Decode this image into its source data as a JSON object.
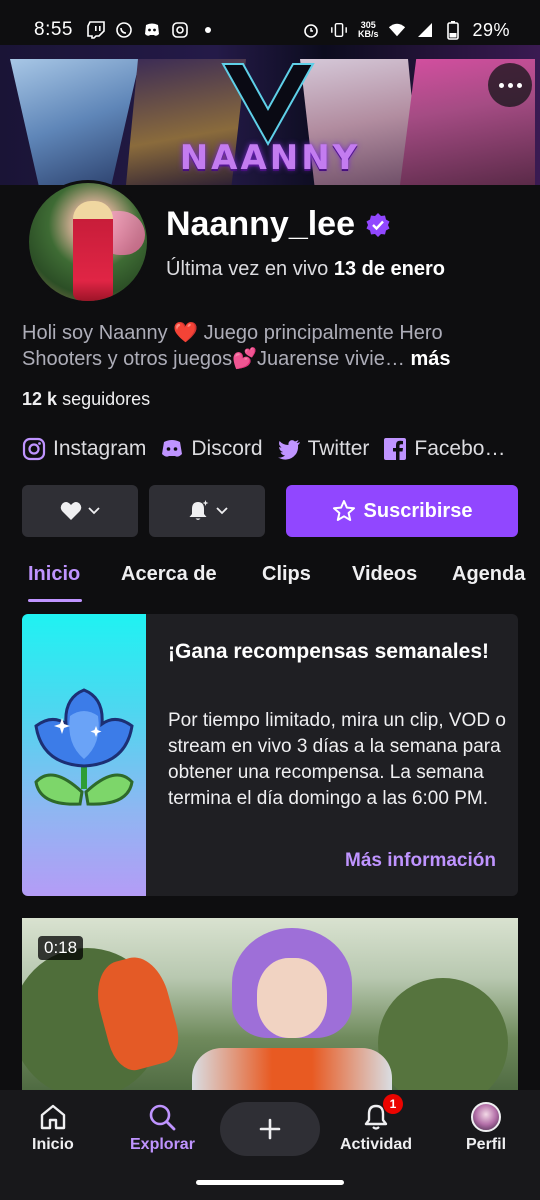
{
  "status_bar": {
    "time": "8:55",
    "speed_value": "305",
    "speed_unit": "KB/s",
    "battery": "29%"
  },
  "banner": {
    "name": "NAANNY"
  },
  "channel": {
    "name": "Naanny_lee",
    "last_live_prefix": "Última vez en vivo",
    "last_live_date": "13 de enero",
    "bio_text": "Holi soy Naanny ❤️ Juego principalmente Hero Shooters y otros juegos💕Juarense vivie…",
    "bio_more": "más",
    "followers_count": "12 k",
    "followers_label": "seguidores"
  },
  "socials": [
    {
      "label": "Instagram",
      "icon": "instagram-icon"
    },
    {
      "label": "Discord",
      "icon": "discord-icon"
    },
    {
      "label": "Twitter",
      "icon": "twitter-icon"
    },
    {
      "label": "Facebo…",
      "icon": "facebook-icon"
    }
  ],
  "actions": {
    "subscribe_label": "Suscribirse",
    "accent": "#9147ff"
  },
  "tabs": [
    {
      "label": "Inicio",
      "active": true
    },
    {
      "label": "Acerca de"
    },
    {
      "label": "Clips"
    },
    {
      "label": "Videos"
    },
    {
      "label": "Agenda"
    }
  ],
  "reward_card": {
    "title": "¡Gana recompensas semanales!",
    "body": "Por tiempo limitado, mira un clip, VOD o stream en vivo 3 días a la semana para obtener una recompensa. La semana termina el día domingo a las 6:00 PM.",
    "link": "Más información"
  },
  "video": {
    "duration": "0:18"
  },
  "bottom_nav": {
    "home": "Inicio",
    "explore": "Explorar",
    "activity": "Actividad",
    "activity_badge": "1",
    "profile": "Perfil"
  }
}
